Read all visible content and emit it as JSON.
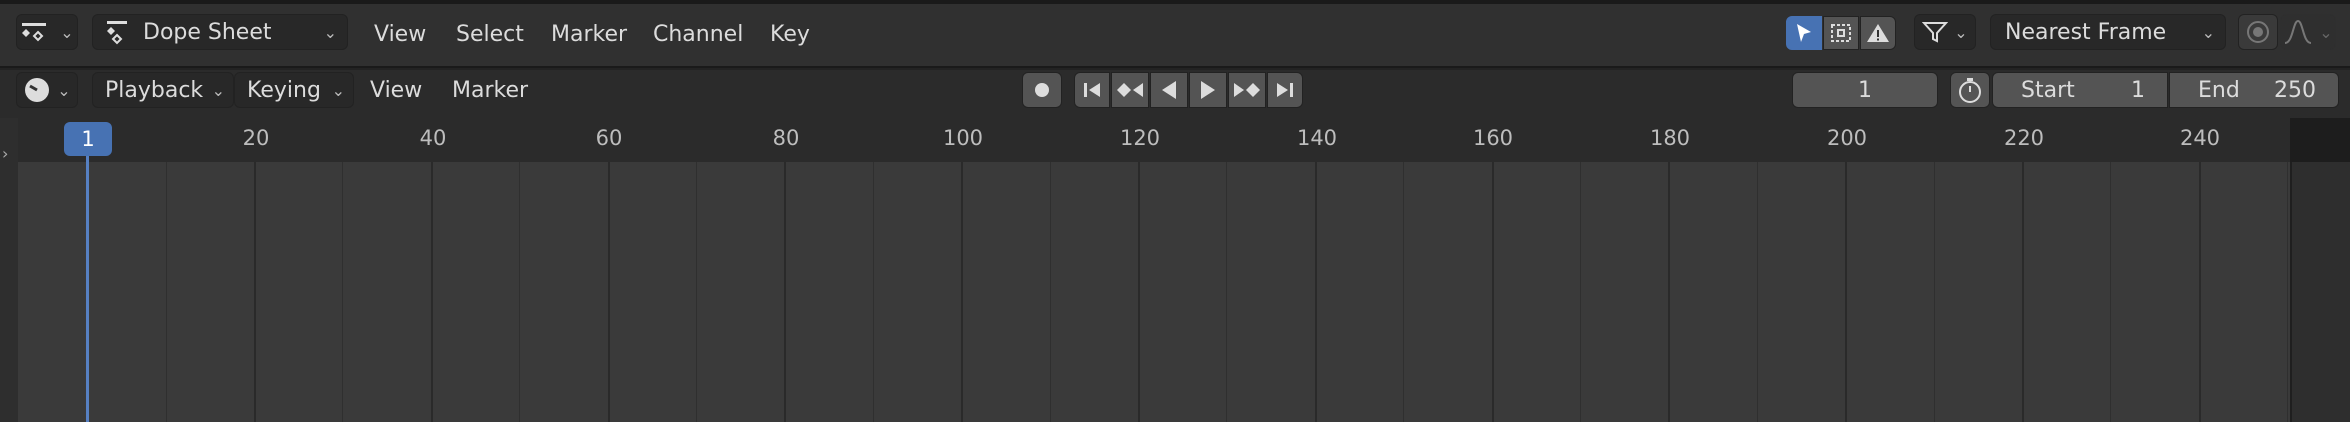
{
  "header1": {
    "editor_type_icon": "dope-sheet-icon",
    "mode_icon": "dope-sheet-mode-icon",
    "mode_label": "Dope Sheet",
    "menus": [
      "View",
      "Select",
      "Marker",
      "Channel",
      "Key"
    ],
    "snap_label": "Nearest Frame"
  },
  "header2": {
    "editor_type_icon": "clock-icon",
    "playback_label": "Playback",
    "keying_label": "Keying",
    "menus": [
      "View",
      "Marker"
    ],
    "current_frame": "1",
    "start_label": "Start",
    "start_value": "1",
    "end_label": "End",
    "end_value": "250"
  },
  "timeline": {
    "current_frame_label": "1",
    "ticks": [
      "20",
      "40",
      "60",
      "80",
      "100",
      "120",
      "140",
      "160",
      "180",
      "200",
      "220",
      "240"
    ]
  },
  "colors": {
    "accent": "#4772b3",
    "header_bg": "#303030",
    "area_bg": "#3a3a3a"
  }
}
